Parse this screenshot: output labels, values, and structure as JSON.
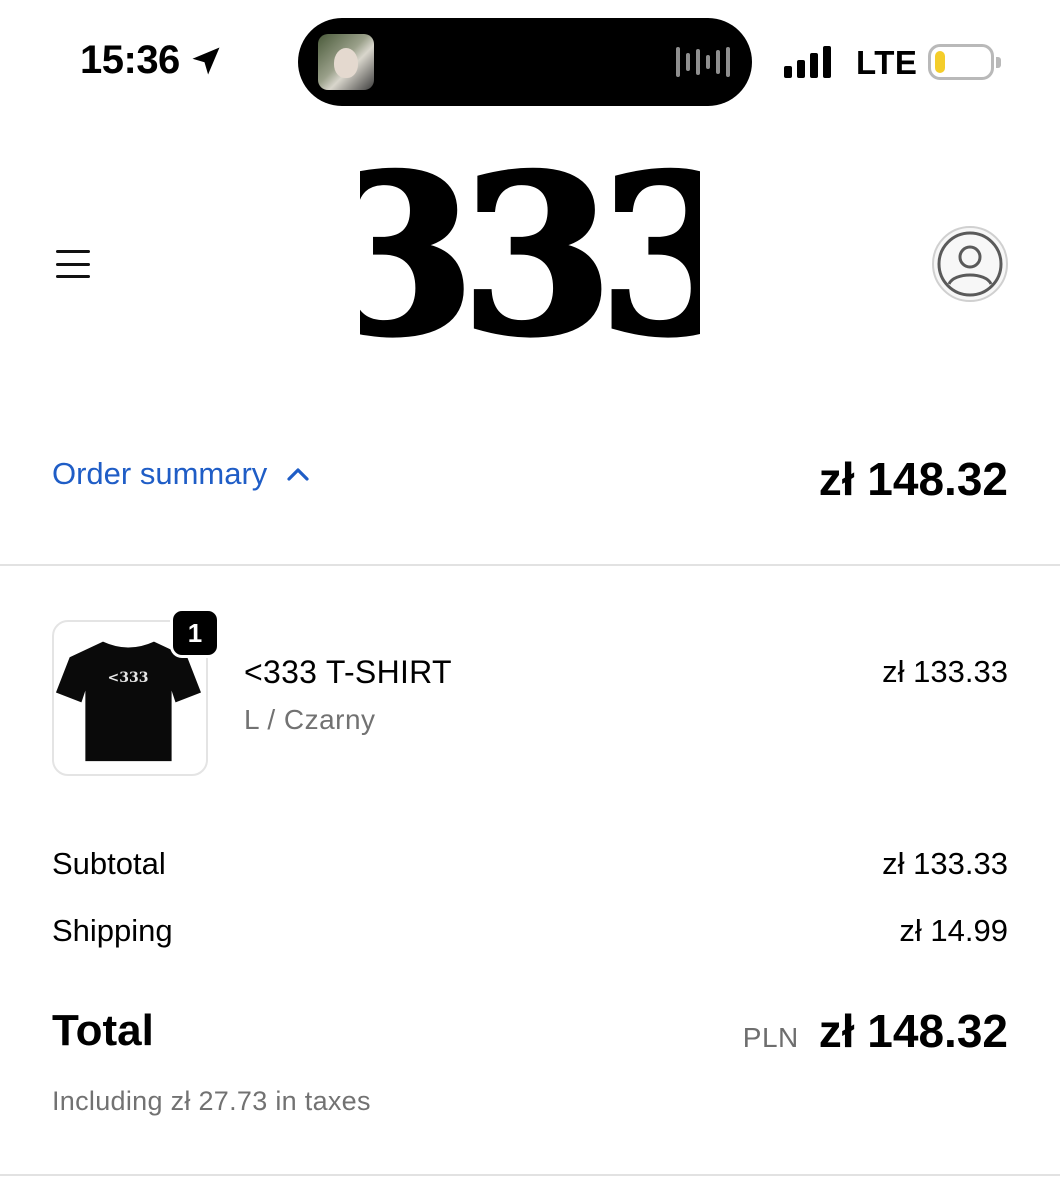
{
  "status_bar": {
    "time": "15:36",
    "network": "LTE",
    "icons": [
      "location-arrow-icon",
      "cellular-signal-icon",
      "battery-icon"
    ],
    "battery_level": 0.2
  },
  "header": {
    "logo_text": "333",
    "icons": [
      "menu-icon",
      "account-icon"
    ]
  },
  "order_summary": {
    "toggle_label": "Order summary",
    "toggle_icon": "chevron-up-icon",
    "total": "zł 148.32",
    "accent_color": "#1f5dc6"
  },
  "line_items": [
    {
      "quantity": "1",
      "name": "<333 T-SHIRT",
      "variant": "L / Czarny",
      "price": "zł 133.33",
      "image_print": "<333"
    }
  ],
  "costs": {
    "subtotal_label": "Subtotal",
    "subtotal_value": "zł 133.33",
    "shipping_label": "Shipping",
    "shipping_value": "zł 14.99",
    "total_label": "Total",
    "total_currency": "PLN",
    "total_value": "zł 148.32",
    "taxes_note": "Including zł 27.73 in taxes"
  }
}
